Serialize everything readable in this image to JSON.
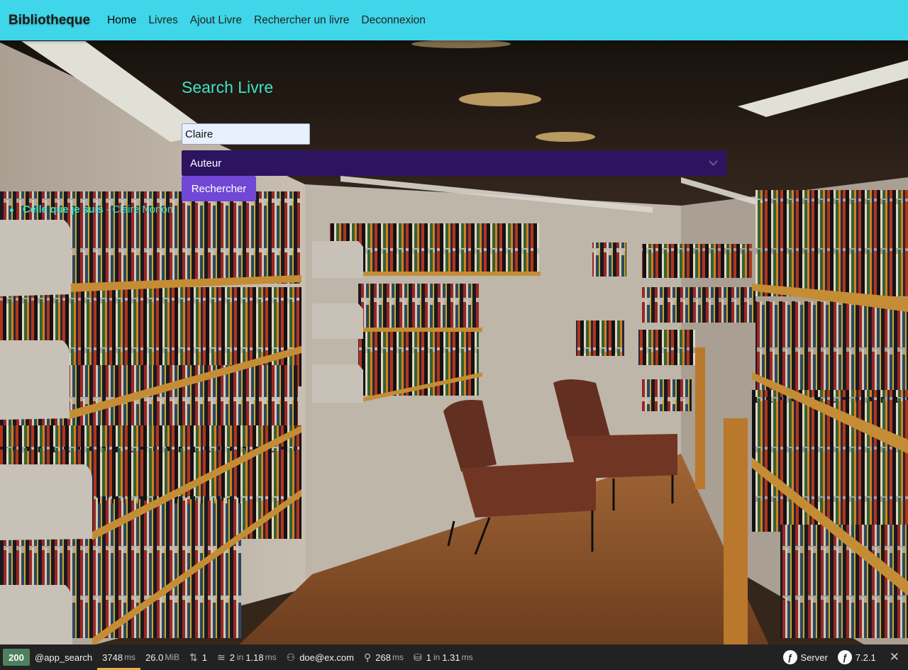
{
  "navbar": {
    "brand": "Bibliotheque",
    "links": [
      "Home",
      "Livres",
      "Ajout Livre",
      "Rechercher un livre",
      "Deconnexion"
    ]
  },
  "search": {
    "title": "Search Livre",
    "input_value": "Claire",
    "select_value": "Auteur",
    "button_label": "Rechercher"
  },
  "results": [
    {
      "title": "Celle que je suis",
      "separator": "-",
      "author": "Claire Norton"
    }
  ],
  "toolbar": {
    "status": "200",
    "route": "@app_search",
    "time_value": "3748",
    "time_unit": "ms",
    "memory_value": "26.0",
    "memory_unit": "MiB",
    "requests": "1",
    "twig": "2",
    "twig_in": "in",
    "twig_time": "1.18",
    "twig_unit": "ms",
    "user": "doe@ex.com",
    "cache_value": "268",
    "cache_unit": "ms",
    "db_queries": "1",
    "db_in": "in",
    "db_time": "1.31",
    "db_unit": "ms",
    "server_label": "Server",
    "symfony_version": "7.2.1"
  },
  "colors": {
    "navbar": "#3ed6e8",
    "accent_text": "#3de4c6",
    "select_bg": "#2c1460",
    "button_bg": "#7147d6",
    "toolbar_bg": "#222222",
    "status_bg": "#4f805d"
  },
  "icons": [
    "requests-icon",
    "layers-icon",
    "user-icon",
    "cache-icon",
    "database-icon",
    "symfony-logo-icon",
    "close-icon"
  ]
}
